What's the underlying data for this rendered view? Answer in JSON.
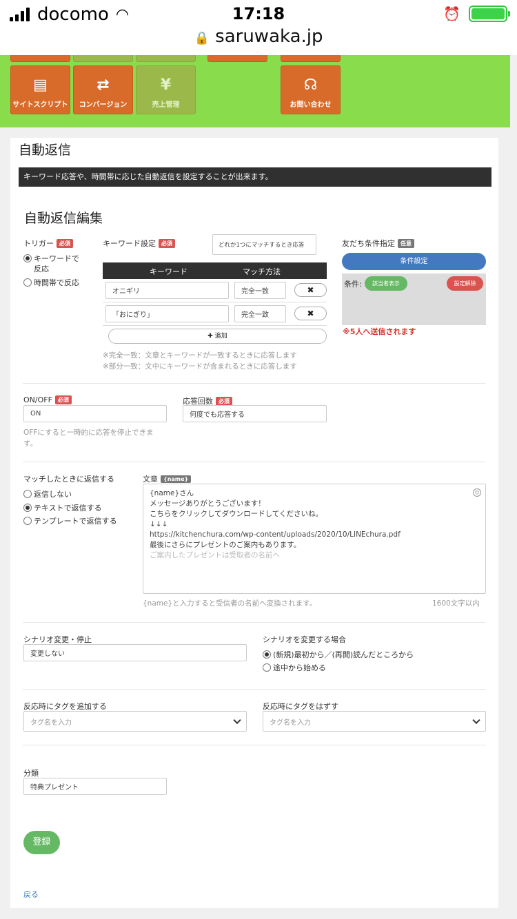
{
  "status_bar": {
    "carrier": "docomo",
    "time": "17:18",
    "url": "saruwaka.jp"
  },
  "menu": {
    "tiles": [
      {
        "label": "サイトスクリプト",
        "icon": "browser-window-icon"
      },
      {
        "label": "コンバージョン",
        "icon": "exchange-arrows-icon"
      },
      {
        "label": "売上管理",
        "icon": "money-bag-icon"
      },
      {
        "label": "お問い合わせ",
        "icon": "headset-support-icon"
      }
    ],
    "icon_glyphs": {
      "browser": "▤",
      "exchange": "⇄",
      "moneybag": "¥",
      "headset": "☊"
    }
  },
  "page": {
    "title": "自動返信",
    "banner": "キーワード応答や、時間帯に応じた自動返信を設定することが出来ます。",
    "section_title": "自動返信編集"
  },
  "badges": {
    "required": "必須",
    "optional": "任意"
  },
  "trigger": {
    "label": "トリガー",
    "options": [
      {
        "line1": "キーワードで",
        "line2": "反応",
        "checked": true
      },
      {
        "line1": "時間帯で反応",
        "line2": "",
        "checked": false
      }
    ]
  },
  "keyword_settings": {
    "label": "キーワード設定",
    "match_mode": "どれか1つにマッチするとき応答",
    "columns": [
      "キーワード",
      "マッチ方法"
    ],
    "rows": [
      {
        "keyword": "オニギリ",
        "method": "完全一致",
        "remove": "✖"
      },
      {
        "keyword": "「おにぎり」",
        "method": "完全一致",
        "remove": "✖"
      }
    ],
    "add_icon": "✚",
    "add_label": "追加",
    "notes": [
      "※完全一致：文章とキーワードが一致するときに応答します",
      "※部分一致：文中にキーワードが含まれるときに応答します"
    ]
  },
  "friend_condition": {
    "label": "友だち条件指定",
    "button": "条件設定",
    "condition_label": "条件:",
    "show_button": "該当者表示",
    "clear_button": "設定解除",
    "result": "※5人へ送信されます"
  },
  "onoff": {
    "label": "ON/OFF",
    "value": "ON",
    "note_line1": "OFFにすると一時的に応答を停止できま",
    "note_line2": "す。"
  },
  "response_count": {
    "label": "応答回数",
    "value": "何度でも応答する"
  },
  "reply": {
    "label": "マッチしたときに返信する",
    "options": [
      {
        "label": "返信しない",
        "checked": false
      },
      {
        "label": "テキストで返信する",
        "checked": true
      },
      {
        "label": "テンプレートで返信する",
        "checked": false
      }
    ]
  },
  "message": {
    "label": "文章",
    "tag": "{name}",
    "lines": [
      "{name}さん",
      "",
      "メッセージありがとうございます！",
      "",
      "こちらをクリックしてダウンロードしてくださいね。",
      "↓↓↓",
      "https://kitchenchura.com/wp-content/uploads/2020/10/LINEchura.pdf",
      "",
      "最後にさらにプレゼントのご案内もあります。",
      "",
      "ご案内したプレゼントは受取者の名前へ"
    ],
    "hint": "{name}と入力すると受信者の名前へ変換されます。",
    "limit": "1600文字以内"
  },
  "scenario": {
    "label": "シナリオ変更・停止",
    "value": "変更しない",
    "change_label": "シナリオを変更する場合",
    "options": [
      {
        "label": "(新規)最初から／(再開)読んだところから",
        "checked": true
      },
      {
        "label": "途中から始める",
        "checked": false
      }
    ]
  },
  "tags": {
    "add_label": "反応時にタグを追加する",
    "add_placeholder": "タグ名を入力",
    "remove_label": "反応時にタグをはずす",
    "remove_placeholder": "タグ名を入力"
  },
  "category": {
    "label": "分類",
    "value": "特典プレゼント"
  },
  "actions": {
    "submit": "登録",
    "back": "戻る"
  },
  "colors": {
    "menu_green": "#89dc4c",
    "tile_orange": "#d96b2a",
    "banner_dark": "#303030",
    "required_red": "#d9534f",
    "primary_blue": "#4479c2",
    "success_green": "#65b864",
    "danger_text": "#d9312c"
  }
}
